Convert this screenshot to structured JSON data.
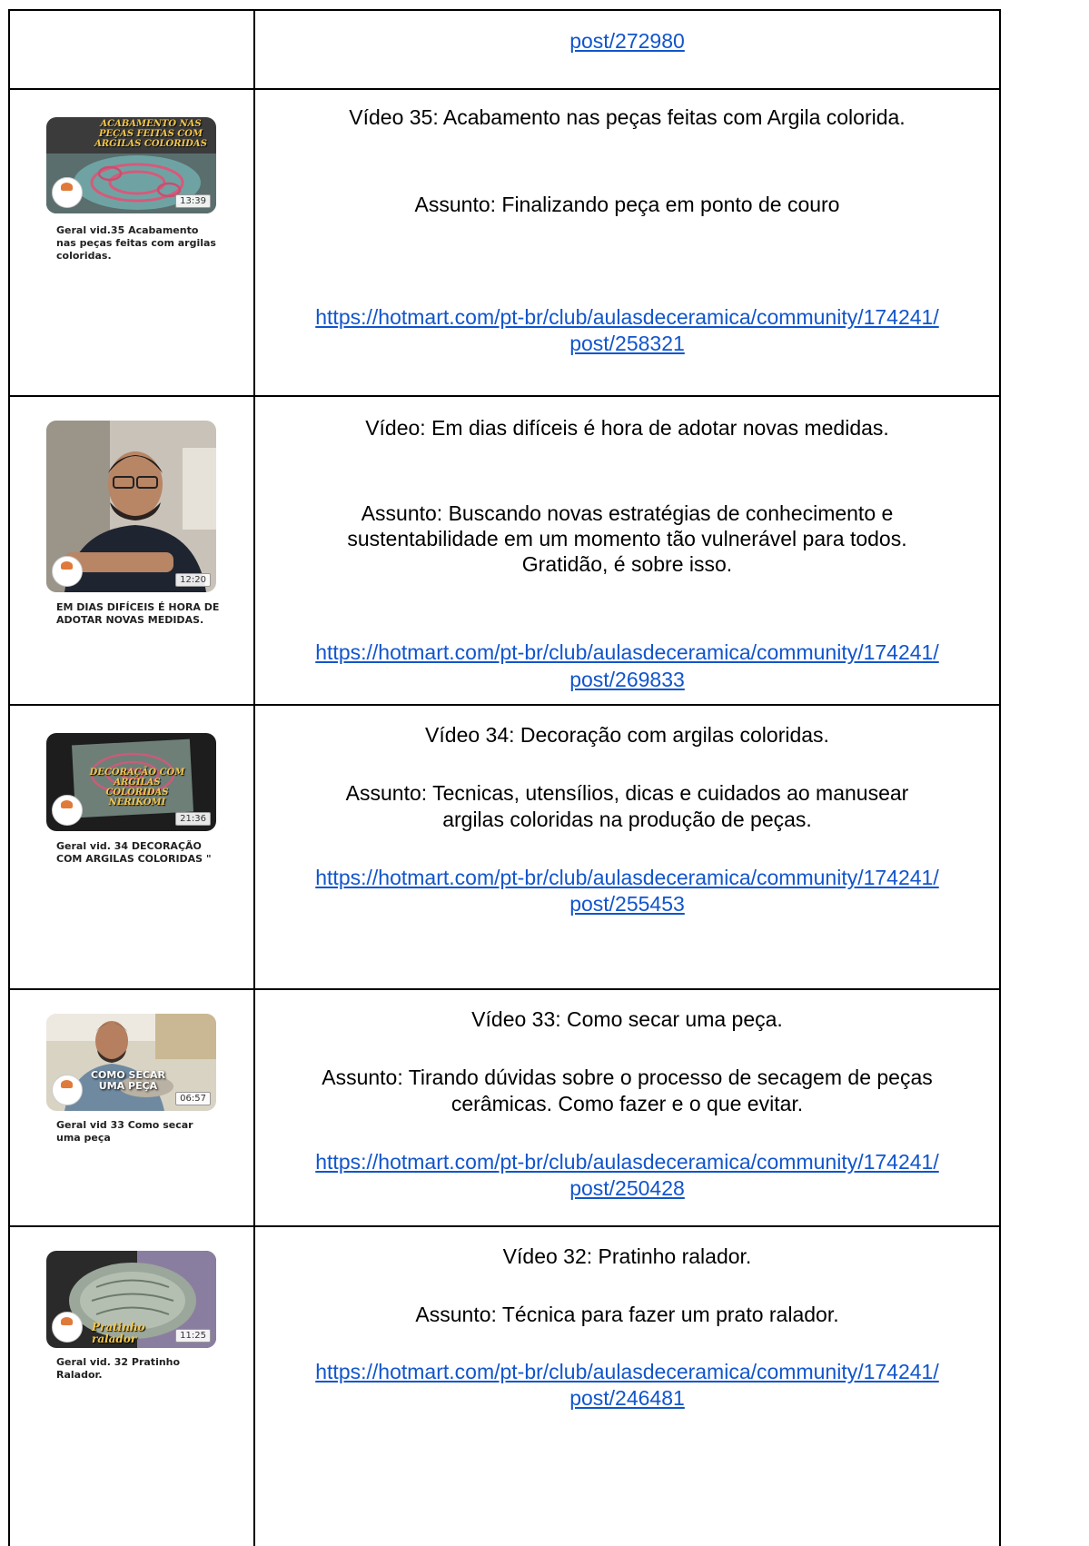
{
  "rows": [
    {
      "link_tail": "post/272980"
    },
    {
      "title": "Vídeo 35: Acabamento nas peças feitas com Argila colorida.",
      "subject": "Assunto: Finalizando peça em ponto de couro",
      "link1": "https://hotmart.com/pt-br/club/aulasdeceramica/community/174241/",
      "link2": "post/258321",
      "caption": "Geral vid.35  Acabamento nas peças feitas com argilas coloridas.",
      "duration": "13:39",
      "overlay": "ACABAMENTO NAS PEÇAS FEITAS COM ARGILAS COLORIDAS"
    },
    {
      "title": "Vídeo: Em dias difíceis é hora de adotar novas medidas.",
      "subject_l1": "Assunto: Buscando novas estratégias de conhecimento e",
      "subject_l2": "sustentabilidade em um momento tão vulnerável para todos.",
      "subject_l3": "Gratidão, é sobre isso.",
      "link1": "https://hotmart.com/pt-br/club/aulasdeceramica/community/174241/",
      "link2": "post/269833",
      "caption": "EM DIAS DIFÍCEIS É HORA DE ADOTAR NOVAS MEDIDAS.",
      "duration": "12:20"
    },
    {
      "title": "Vídeo 34: Decoração com argilas coloridas.",
      "subject_l1": "Assunto: Tecnicas, utensílios, dicas e cuidados ao manusear",
      "subject_l2": "argilas coloridas na produção de peças.",
      "link1": "https://hotmart.com/pt-br/club/aulasdeceramica/community/174241/",
      "link2": "post/255453",
      "caption": "Geral vid. 34 DECORAÇÃO COM ARGILAS COLORIDAS \"",
      "duration": "21:36",
      "overlay": "DECORAÇÃO COM ARGILAS COLORIDAS NERIKOMI"
    },
    {
      "title": "Vídeo 33: Como secar uma peça.",
      "subject_l1": "Assunto: Tirando dúvidas sobre o processo de secagem de peças",
      "subject_l2": "cerâmicas. Como fazer e o que evitar.",
      "link1": "https://hotmart.com/pt-br/club/aulasdeceramica/community/174241/",
      "link2": "post/250428",
      "caption": "Geral vid 33 Como secar uma peça",
      "duration": "06:57",
      "overlay": "COMO SECAR UMA PEÇA"
    },
    {
      "title": "Vídeo 32: Pratinho ralador.",
      "subject": "Assunto: Técnica para fazer um prato ralador.",
      "link1": "https://hotmart.com/pt-br/club/aulasdeceramica/community/174241/",
      "link2": "post/246481",
      "caption": "Geral vid. 32 Pratinho Ralador.",
      "duration": "11:25",
      "overlay": "Pratinho ralador"
    }
  ],
  "colors": {
    "link": "#1155cc",
    "border": "#000000"
  }
}
